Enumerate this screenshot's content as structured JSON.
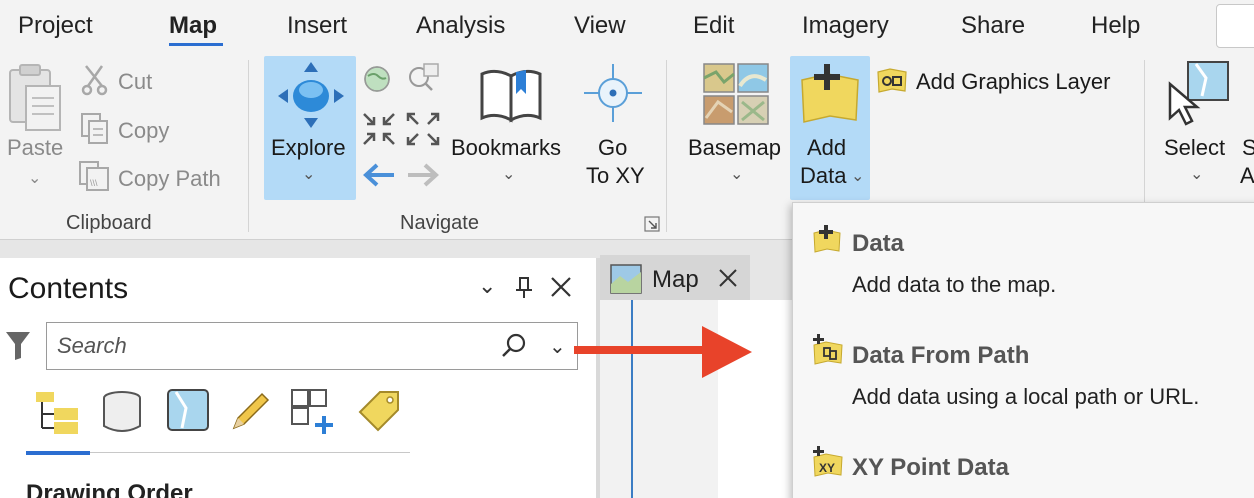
{
  "menu": {
    "tabs": [
      {
        "label": "Project"
      },
      {
        "label": "Map"
      },
      {
        "label": "Insert"
      },
      {
        "label": "Analysis"
      },
      {
        "label": "View"
      },
      {
        "label": "Edit"
      },
      {
        "label": "Imagery"
      },
      {
        "label": "Share"
      },
      {
        "label": "Help"
      }
    ],
    "active": "Map"
  },
  "ribbon": {
    "clipboard": {
      "paste": "Paste",
      "cut": "Cut",
      "copy": "Copy",
      "copy_path": "Copy Path",
      "group_label": "Clipboard"
    },
    "navigate": {
      "explore": "Explore",
      "bookmarks": "Bookmarks",
      "go_to_xy_line1": "Go",
      "go_to_xy_line2": "To XY",
      "group_label": "Navigate"
    },
    "layer": {
      "basemap": "Basemap",
      "add_data_line1": "Add",
      "add_data_line2": "Data",
      "add_graphics_layer": "Add Graphics Layer"
    },
    "selection": {
      "select": "Select",
      "partial_1": "S",
      "partial_2": "A"
    }
  },
  "contents": {
    "title": "Contents",
    "search_placeholder": "Search",
    "drawing_order": "Drawing Order"
  },
  "map_tab": {
    "label": "Map"
  },
  "add_data_menu": {
    "items": [
      {
        "title": "Data",
        "description": "Add data to the map."
      },
      {
        "title": "Data From Path",
        "description": "Add data using a local path or URL."
      },
      {
        "title": "XY Point Data",
        "description": ""
      }
    ]
  },
  "colors": {
    "accent": "#2b6ed1",
    "selected": "#b3daf7",
    "arrow": "#e8432a",
    "folder_yellow": "#f0d75e"
  }
}
